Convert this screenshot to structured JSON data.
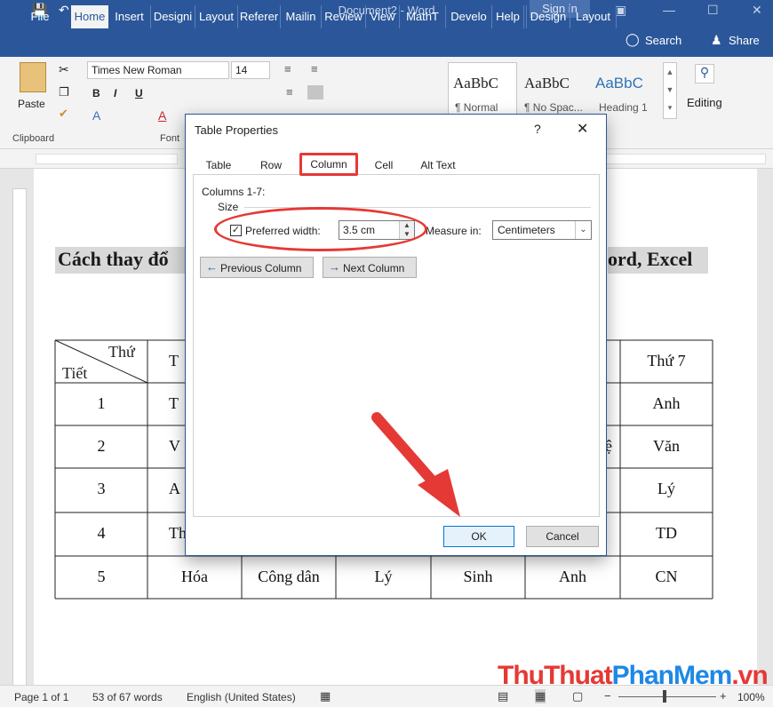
{
  "window": {
    "title": "Document2 - Word",
    "sign_in": "Sign in"
  },
  "tabs": [
    "File",
    "Home",
    "Insert",
    "Design",
    "Layout",
    "References",
    "Mailings",
    "Review",
    "View",
    "MathType",
    "Developer",
    "Help",
    "Design",
    "Layout"
  ],
  "tab_labels": [
    "File",
    "Home",
    "Insert",
    "Designi",
    "Layout",
    "Referer",
    "Mailin",
    "Review",
    "View",
    "MathT",
    "Develo",
    "Help",
    "Design",
    "Layout"
  ],
  "tell_me": "Search",
  "share": "Share",
  "ribbon": {
    "paste": "Paste",
    "clipboard": "Clipboard",
    "font_name": "Times New Roman",
    "font_size": "14",
    "font_group": "Font",
    "styles": [
      {
        "sample": "AaBbC",
        "name": "¶ Normal"
      },
      {
        "sample": "AaBbC",
        "name": "¶ No Spac..."
      },
      {
        "sample": "AaBbC",
        "name": "Heading 1"
      }
    ],
    "editing": "Editing"
  },
  "document": {
    "heading_left": "Cách thay đổ",
    "heading_right": "ord, Excel",
    "table": {
      "corner_top": "Thứ",
      "corner_bottom": "Tiết",
      "rows": [
        [
          "",
          "T",
          "",
          "",
          "",
          "",
          "Thứ 7"
        ],
        [
          "1",
          "T",
          "",
          "",
          "",
          "",
          "Anh"
        ],
        [
          "2",
          "V",
          "",
          "",
          "",
          "ệ",
          "Văn"
        ],
        [
          "3",
          "A",
          "",
          "",
          "",
          "",
          "Lý"
        ],
        [
          "4",
          "Th",
          "",
          "",
          "",
          "",
          "TD"
        ],
        [
          "5",
          "Hóa",
          "Công dân",
          "Lý",
          "Sinh",
          "Anh",
          "CN"
        ]
      ]
    }
  },
  "dialog": {
    "title": "Table Properties",
    "help": "?",
    "tabs": [
      "Table",
      "Row",
      "Column",
      "Cell",
      "Alt Text"
    ],
    "columns_label": "Columns 1-7:",
    "size_label": "Size",
    "preferred_width_label": "Preferred width:",
    "preferred_width_value": "3.5 cm",
    "measure_in_label": "Measure in:",
    "measure_in_value": "Centimeters",
    "prev_col": "Previous Column",
    "next_col": "Next Column",
    "ok": "OK",
    "cancel": "Cancel"
  },
  "status": {
    "page": "Page 1 of 1",
    "words": "53 of 67 words",
    "language": "English (United States)",
    "zoom": "100%"
  },
  "watermark": {
    "part1": "ThuThuat",
    "part2": "PhanMem",
    "part3": ".vn"
  },
  "colors": {
    "word_blue": "#2b579a",
    "annotation_red": "#e53935"
  }
}
